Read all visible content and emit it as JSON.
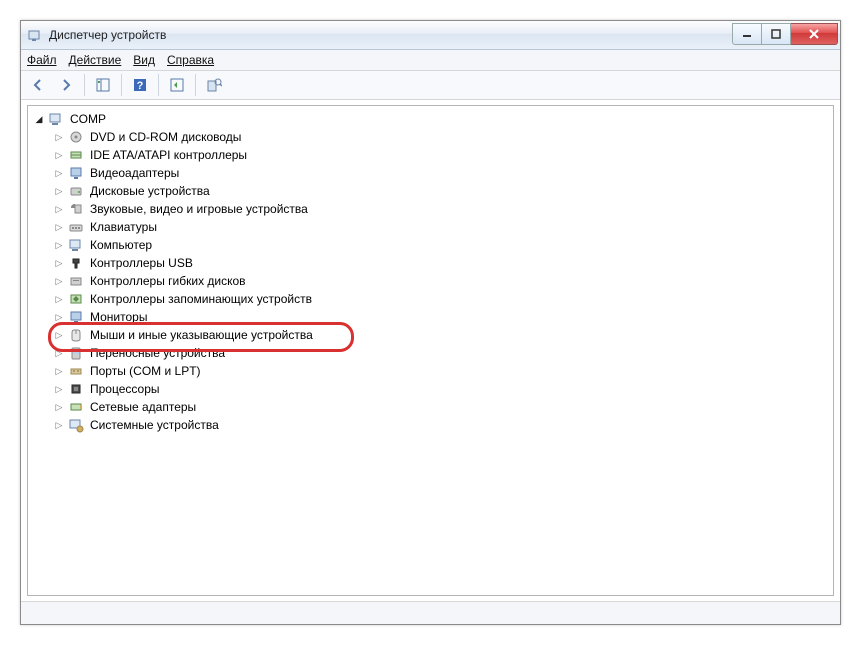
{
  "window": {
    "title": "Диспетчер устройств"
  },
  "menu": {
    "file": "Файл",
    "action": "Действие",
    "view": "Вид",
    "help": "Справка"
  },
  "tree": {
    "root": "COMP",
    "items": [
      {
        "label": "DVD и CD-ROM дисководы"
      },
      {
        "label": "IDE ATA/ATAPI контроллеры"
      },
      {
        "label": "Видеоадаптеры"
      },
      {
        "label": "Дисковые устройства"
      },
      {
        "label": "Звуковые, видео и игровые устройства"
      },
      {
        "label": "Клавиатуры"
      },
      {
        "label": "Компьютер"
      },
      {
        "label": "Контроллеры USB"
      },
      {
        "label": "Контроллеры гибких дисков"
      },
      {
        "label": "Контроллеры запоминающих устройств"
      },
      {
        "label": "Мониторы"
      },
      {
        "label": "Мыши и иные указывающие устройства",
        "highlighted": true
      },
      {
        "label": "Переносные устройства"
      },
      {
        "label": "Порты (COM и LPT)"
      },
      {
        "label": "Процессоры"
      },
      {
        "label": "Сетевые адаптеры"
      },
      {
        "label": "Системные устройства"
      }
    ]
  }
}
